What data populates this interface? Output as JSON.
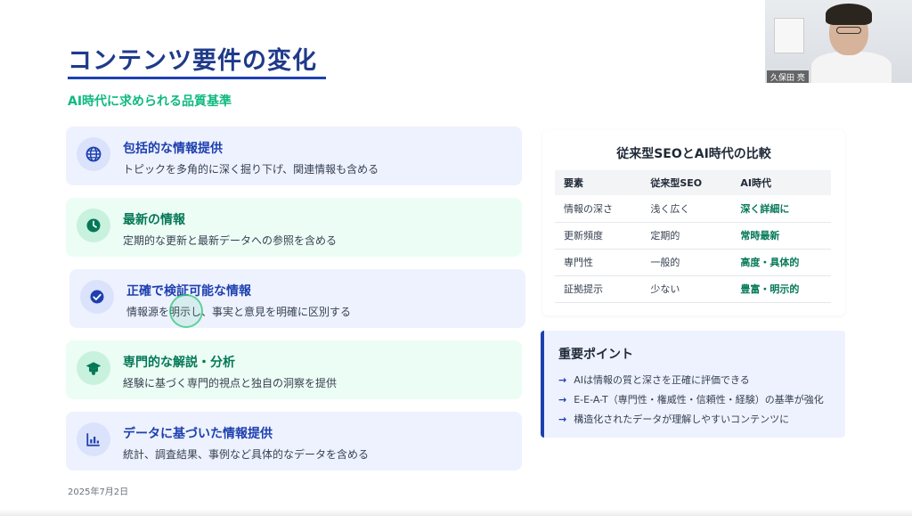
{
  "slide": {
    "title": "コンテンツ要件の変化",
    "subtitle": "AI時代に求められる品質基準",
    "date": "2025年7月2日"
  },
  "cards": [
    {
      "title": "包括的な情報提供",
      "desc": "トピックを多角的に深く掘り下げ、関連情報も含める",
      "icon": "globe-icon",
      "color": "#1e40af"
    },
    {
      "title": "最新の情報",
      "desc": "定期的な更新と最新データへの参照を含める",
      "icon": "clock-icon",
      "color": "#047857"
    },
    {
      "title": "正確で検証可能な情報",
      "desc": "情報源を明示し、事実と意見を明確に区別する",
      "icon": "check-circle-icon",
      "color": "#1e40af"
    },
    {
      "title": "専門的な解説・分析",
      "desc": "経験に基づく専門的視点と独自の洞察を提供",
      "icon": "graduation-cap-icon",
      "color": "#047857"
    },
    {
      "title": "データに基づいた情報提供",
      "desc": "統計、調査結果、事例など具体的なデータを含める",
      "icon": "bar-chart-icon",
      "color": "#1e40af"
    }
  ],
  "comparison": {
    "title": "従来型SEOとAI時代の比較",
    "headers": [
      "要素",
      "従来型SEO",
      "AI時代"
    ],
    "rows": [
      [
        "情報の深さ",
        "浅く広く",
        "深く詳細に"
      ],
      [
        "更新頻度",
        "定期的",
        "常時最新"
      ],
      [
        "専門性",
        "一般的",
        "高度・具体的"
      ],
      [
        "証拠提示",
        "少ない",
        "豊富・明示的"
      ]
    ]
  },
  "points": {
    "title": "重要ポイント",
    "items": [
      "AIは情報の質と深さを正確に評価できる",
      "E-E-A-T（専門性・権威性・信頼性・経験）の基準が強化",
      "構造化されたデータが理解しやすいコンテンツに"
    ]
  },
  "video": {
    "name": "久保田 亮"
  },
  "colors": {
    "title": "#1e3a8a",
    "accent_green": "#10b981",
    "card_blue": "#eef2ff",
    "card_green": "#ecfdf5"
  }
}
